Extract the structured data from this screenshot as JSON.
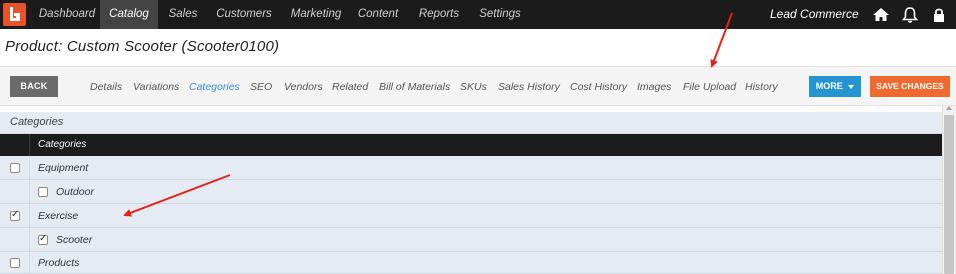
{
  "nav": {
    "items": [
      "Dashboard",
      "Catalog",
      "Sales",
      "Customers",
      "Marketing",
      "Content",
      "Reports",
      "Settings"
    ],
    "brand": "Lead Commerce"
  },
  "page": {
    "title": "Product: Custom Scooter (Scooter0100)"
  },
  "toolbar": {
    "back_label": "BACK",
    "tabs": [
      "Details",
      "Variations",
      "Categories",
      "SEO",
      "Vendors",
      "Related",
      "Bill of Materials",
      "SKUs",
      "Sales History",
      "Cost History",
      "Images",
      "File Upload",
      "History"
    ],
    "active_tab": "Categories",
    "more_label": "MORE",
    "save_label": "SAVE CHANGES"
  },
  "categories": {
    "panel_title": "Categories",
    "column_header": "Categories",
    "rows": [
      {
        "label": "Equipment",
        "checked": false,
        "level": 0
      },
      {
        "label": "Outdoor",
        "checked": false,
        "level": 1
      },
      {
        "label": "Exercise",
        "checked": true,
        "level": 0
      },
      {
        "label": "Scooter",
        "checked": true,
        "level": 1
      },
      {
        "label": "Products",
        "checked": false,
        "level": 0
      }
    ]
  },
  "colors": {
    "nav_bg": "#1b1b1b",
    "accent_blue": "#2594d3",
    "save_orange": "#ef6a2e",
    "logo_orange": "#e8542a",
    "annotation_red": "#e8201c"
  },
  "icons": [
    "logo-icon",
    "home-icon",
    "bell-icon",
    "lock-icon",
    "caret-down-icon"
  ]
}
